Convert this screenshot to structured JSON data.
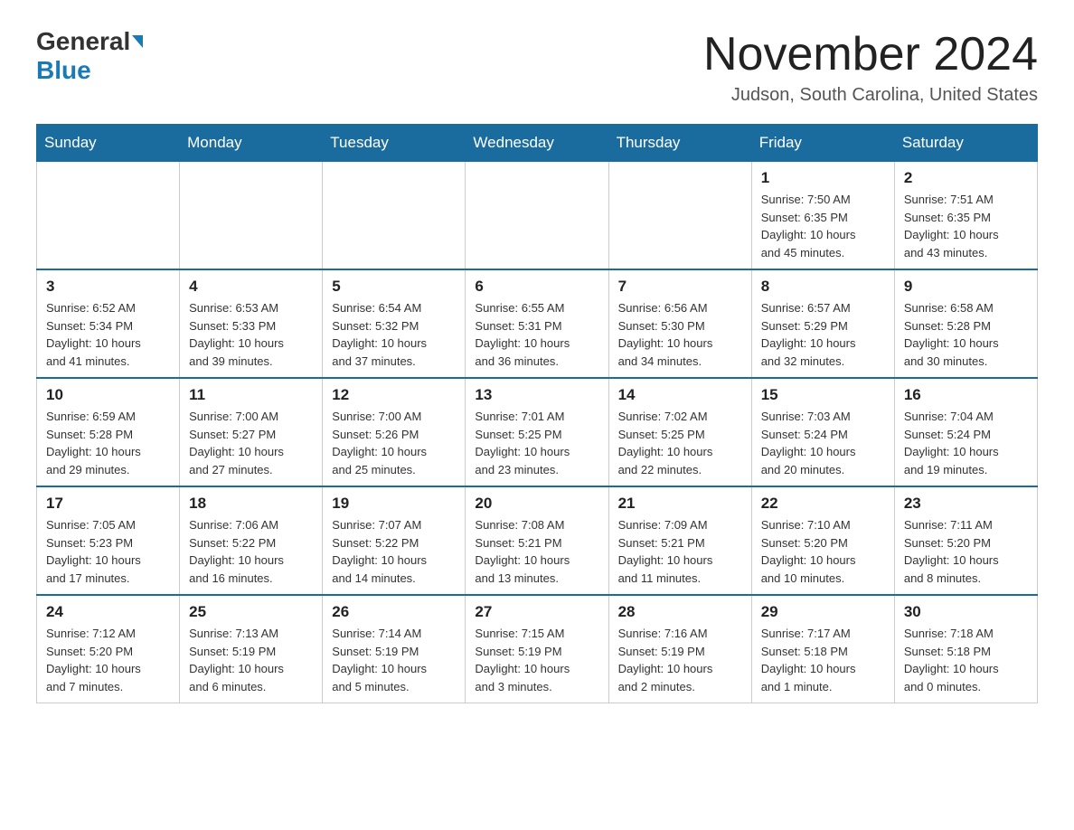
{
  "logo": {
    "general": "General",
    "blue": "Blue"
  },
  "title": "November 2024",
  "location": "Judson, South Carolina, United States",
  "days_of_week": [
    "Sunday",
    "Monday",
    "Tuesday",
    "Wednesday",
    "Thursday",
    "Friday",
    "Saturday"
  ],
  "weeks": [
    [
      {
        "day": "",
        "info": ""
      },
      {
        "day": "",
        "info": ""
      },
      {
        "day": "",
        "info": ""
      },
      {
        "day": "",
        "info": ""
      },
      {
        "day": "",
        "info": ""
      },
      {
        "day": "1",
        "info": "Sunrise: 7:50 AM\nSunset: 6:35 PM\nDaylight: 10 hours\nand 45 minutes."
      },
      {
        "day": "2",
        "info": "Sunrise: 7:51 AM\nSunset: 6:35 PM\nDaylight: 10 hours\nand 43 minutes."
      }
    ],
    [
      {
        "day": "3",
        "info": "Sunrise: 6:52 AM\nSunset: 5:34 PM\nDaylight: 10 hours\nand 41 minutes."
      },
      {
        "day": "4",
        "info": "Sunrise: 6:53 AM\nSunset: 5:33 PM\nDaylight: 10 hours\nand 39 minutes."
      },
      {
        "day": "5",
        "info": "Sunrise: 6:54 AM\nSunset: 5:32 PM\nDaylight: 10 hours\nand 37 minutes."
      },
      {
        "day": "6",
        "info": "Sunrise: 6:55 AM\nSunset: 5:31 PM\nDaylight: 10 hours\nand 36 minutes."
      },
      {
        "day": "7",
        "info": "Sunrise: 6:56 AM\nSunset: 5:30 PM\nDaylight: 10 hours\nand 34 minutes."
      },
      {
        "day": "8",
        "info": "Sunrise: 6:57 AM\nSunset: 5:29 PM\nDaylight: 10 hours\nand 32 minutes."
      },
      {
        "day": "9",
        "info": "Sunrise: 6:58 AM\nSunset: 5:28 PM\nDaylight: 10 hours\nand 30 minutes."
      }
    ],
    [
      {
        "day": "10",
        "info": "Sunrise: 6:59 AM\nSunset: 5:28 PM\nDaylight: 10 hours\nand 29 minutes."
      },
      {
        "day": "11",
        "info": "Sunrise: 7:00 AM\nSunset: 5:27 PM\nDaylight: 10 hours\nand 27 minutes."
      },
      {
        "day": "12",
        "info": "Sunrise: 7:00 AM\nSunset: 5:26 PM\nDaylight: 10 hours\nand 25 minutes."
      },
      {
        "day": "13",
        "info": "Sunrise: 7:01 AM\nSunset: 5:25 PM\nDaylight: 10 hours\nand 23 minutes."
      },
      {
        "day": "14",
        "info": "Sunrise: 7:02 AM\nSunset: 5:25 PM\nDaylight: 10 hours\nand 22 minutes."
      },
      {
        "day": "15",
        "info": "Sunrise: 7:03 AM\nSunset: 5:24 PM\nDaylight: 10 hours\nand 20 minutes."
      },
      {
        "day": "16",
        "info": "Sunrise: 7:04 AM\nSunset: 5:24 PM\nDaylight: 10 hours\nand 19 minutes."
      }
    ],
    [
      {
        "day": "17",
        "info": "Sunrise: 7:05 AM\nSunset: 5:23 PM\nDaylight: 10 hours\nand 17 minutes."
      },
      {
        "day": "18",
        "info": "Sunrise: 7:06 AM\nSunset: 5:22 PM\nDaylight: 10 hours\nand 16 minutes."
      },
      {
        "day": "19",
        "info": "Sunrise: 7:07 AM\nSunset: 5:22 PM\nDaylight: 10 hours\nand 14 minutes."
      },
      {
        "day": "20",
        "info": "Sunrise: 7:08 AM\nSunset: 5:21 PM\nDaylight: 10 hours\nand 13 minutes."
      },
      {
        "day": "21",
        "info": "Sunrise: 7:09 AM\nSunset: 5:21 PM\nDaylight: 10 hours\nand 11 minutes."
      },
      {
        "day": "22",
        "info": "Sunrise: 7:10 AM\nSunset: 5:20 PM\nDaylight: 10 hours\nand 10 minutes."
      },
      {
        "day": "23",
        "info": "Sunrise: 7:11 AM\nSunset: 5:20 PM\nDaylight: 10 hours\nand 8 minutes."
      }
    ],
    [
      {
        "day": "24",
        "info": "Sunrise: 7:12 AM\nSunset: 5:20 PM\nDaylight: 10 hours\nand 7 minutes."
      },
      {
        "day": "25",
        "info": "Sunrise: 7:13 AM\nSunset: 5:19 PM\nDaylight: 10 hours\nand 6 minutes."
      },
      {
        "day": "26",
        "info": "Sunrise: 7:14 AM\nSunset: 5:19 PM\nDaylight: 10 hours\nand 5 minutes."
      },
      {
        "day": "27",
        "info": "Sunrise: 7:15 AM\nSunset: 5:19 PM\nDaylight: 10 hours\nand 3 minutes."
      },
      {
        "day": "28",
        "info": "Sunrise: 7:16 AM\nSunset: 5:19 PM\nDaylight: 10 hours\nand 2 minutes."
      },
      {
        "day": "29",
        "info": "Sunrise: 7:17 AM\nSunset: 5:18 PM\nDaylight: 10 hours\nand 1 minute."
      },
      {
        "day": "30",
        "info": "Sunrise: 7:18 AM\nSunset: 5:18 PM\nDaylight: 10 hours\nand 0 minutes."
      }
    ]
  ]
}
